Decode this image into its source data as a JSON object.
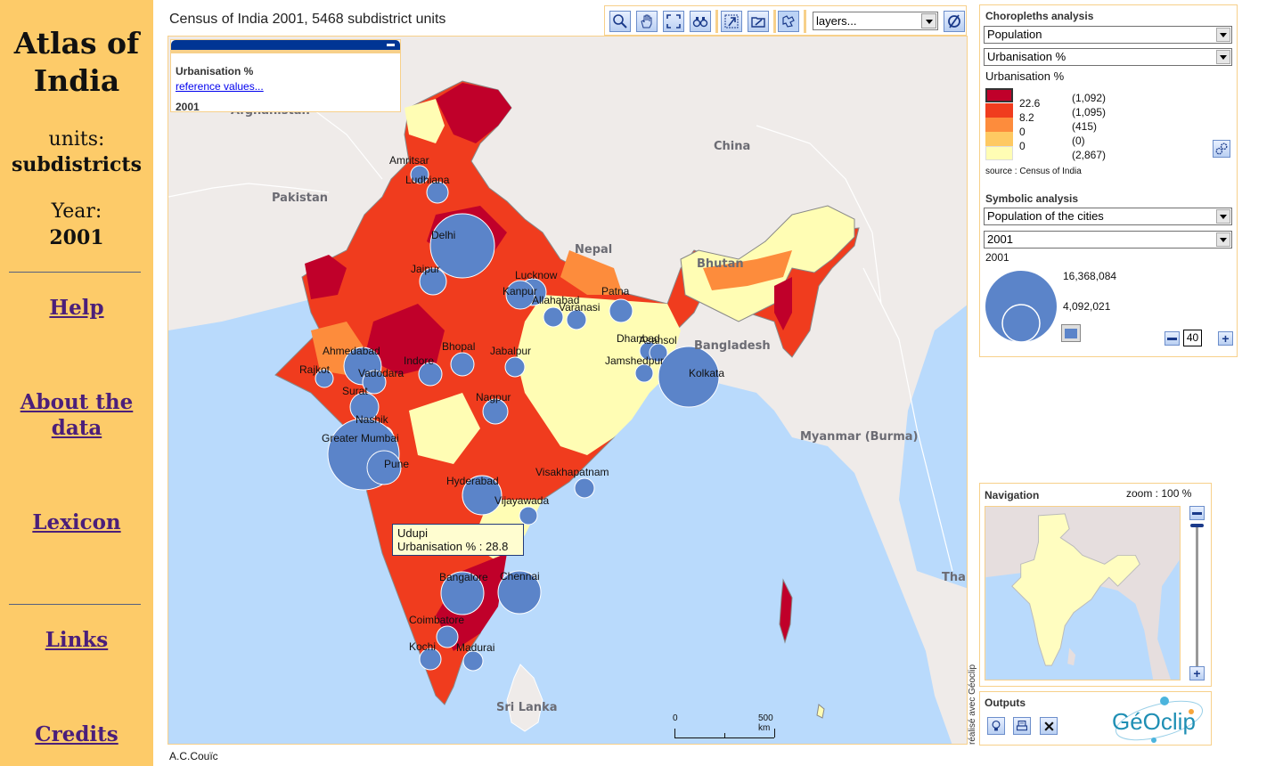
{
  "sidebar": {
    "title": "Atlas of India",
    "units_label": "units:",
    "units_value": "subdistricts",
    "year_label": "Year:",
    "year_value": "2001",
    "links": [
      {
        "label": "Help"
      },
      {
        "label": "About the data"
      },
      {
        "label": "Lexicon"
      },
      {
        "label": "Links"
      },
      {
        "label": "Credits"
      }
    ]
  },
  "header": {
    "title": "Census of India 2001, 5468 subdistrict units"
  },
  "toolbar": {
    "buttons": [
      {
        "icon": "zoom-icon"
      },
      {
        "icon": "pan-hand-icon"
      },
      {
        "icon": "full-extent-icon"
      },
      {
        "icon": "binoculars-icon"
      },
      {
        "icon": "select-area-icon"
      },
      {
        "icon": "open-folder-icon"
      },
      {
        "icon": "map-outline-icon"
      }
    ],
    "layers_select": "layers...",
    "clear_icon": "no-symbol-icon"
  },
  "info_panel": {
    "indicator": "Urbanisation %",
    "reference_link": "reference values...",
    "year": "2001"
  },
  "map": {
    "country_labels": [
      "Afghanistan",
      "Pakistan",
      "China",
      "Nepal",
      "Bhutan",
      "Bangladesh",
      "Myanmar (Burma)",
      "Sri Lanka",
      "Thailand"
    ],
    "cities": [
      {
        "name": "Amritsar"
      },
      {
        "name": "Ludhiana"
      },
      {
        "name": "Delhi"
      },
      {
        "name": "Jaipur"
      },
      {
        "name": "Lucknow"
      },
      {
        "name": "Kanpur"
      },
      {
        "name": "Allahabad"
      },
      {
        "name": "Varanasi"
      },
      {
        "name": "Patna"
      },
      {
        "name": "Dhanbad"
      },
      {
        "name": "Asansol"
      },
      {
        "name": "Jamshedpur"
      },
      {
        "name": "Kolkata"
      },
      {
        "name": "Ahmedabad"
      },
      {
        "name": "Vadodara"
      },
      {
        "name": "Rajkot"
      },
      {
        "name": "Surat"
      },
      {
        "name": "Indore"
      },
      {
        "name": "Bhopal"
      },
      {
        "name": "Jabalpur"
      },
      {
        "name": "Nagpur"
      },
      {
        "name": "Nashik"
      },
      {
        "name": "Greater Mumbai"
      },
      {
        "name": "Pune"
      },
      {
        "name": "Hyderabad"
      },
      {
        "name": "Visakhapatnam"
      },
      {
        "name": "Vijayawada"
      },
      {
        "name": "Bangalore"
      },
      {
        "name": "Chennai"
      },
      {
        "name": "Coimbatore"
      },
      {
        "name": "Kochi"
      },
      {
        "name": "Madurai"
      }
    ],
    "tooltip": {
      "place": "Udupi",
      "value_line": "Urbanisation % : 28.8"
    },
    "scale": {
      "start": "0",
      "end": "500 km"
    },
    "geoclip_credit": "réalisé avec Géoclip"
  },
  "choropleth": {
    "title": "Choropleths analysis",
    "theme_select": "Population",
    "indicator_select": "Urbanisation %",
    "indicator_label": "Urbanisation %",
    "classes": [
      {
        "color": "#c0002a",
        "threshold": "",
        "count": "(1,092)"
      },
      {
        "color": "#f03c1e",
        "threshold": "22.6",
        "count": "(1,095)"
      },
      {
        "color": "#fd8c3c",
        "threshold": "8.2",
        "count": "(415)"
      },
      {
        "color": "#fec962",
        "threshold": "0",
        "count": "(0)"
      },
      {
        "color": "#fffdb4",
        "threshold": "0",
        "count": "(2,867)"
      }
    ],
    "source": "source : Census of India",
    "settings_icon": "gears-icon"
  },
  "symbolic": {
    "title": "Symbolic analysis",
    "variable_select": "Population of the cities",
    "year_select": "2001",
    "year_label": "2001",
    "max_value": "16,368,084",
    "mid_value": "4,092,021",
    "symbol_color": "#5b84c9",
    "size_value": "40"
  },
  "navigation": {
    "title": "Navigation",
    "zoom_label": "zoom : 100 %"
  },
  "outputs": {
    "title": "Outputs",
    "logo_text": "GéOclip"
  },
  "footer": {
    "author": "A.C.Couïc"
  }
}
